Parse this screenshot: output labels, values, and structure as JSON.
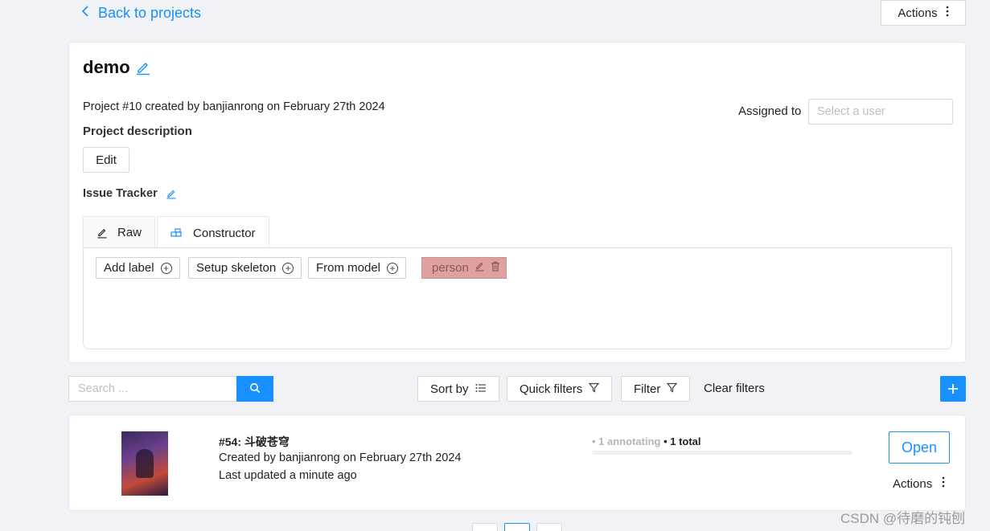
{
  "nav": {
    "back_label": "Back to projects",
    "actions_label": "Actions"
  },
  "project": {
    "name": "demo",
    "meta": "Project #10 created by banjianrong on February 27th 2024",
    "description_label": "Project description",
    "edit_label": "Edit",
    "assigned_label": "Assigned to",
    "assign_placeholder": "Select a user",
    "issue_tracker_label": "Issue Tracker",
    "tabs": [
      {
        "label": "Raw",
        "icon": "pencil-icon"
      },
      {
        "label": "Constructor",
        "icon": "blocks-icon"
      }
    ],
    "active_tab": "Constructor",
    "constructor": {
      "add_label": "Add label",
      "setup_skeleton": "Setup skeleton",
      "from_model": "From model",
      "labels": [
        {
          "name": "person",
          "color": "#dfa0a0"
        }
      ]
    }
  },
  "toolbar": {
    "search_placeholder": "Search ...",
    "sort_by": "Sort by",
    "quick_filters": "Quick filters",
    "filter": "Filter",
    "clear_filters": "Clear filters"
  },
  "tasks": [
    {
      "title": "#54: 斗破苍穹",
      "created": "Created by banjianrong on February 27th 2024",
      "updated": "Last updated a minute ago",
      "status_annotating": "• 1 annotating",
      "status_total": " • 1 total",
      "progress": 0,
      "open_label": "Open",
      "actions_label": "Actions"
    }
  ],
  "watermark": "CSDN @待磨的钝刨",
  "colors": {
    "accent": "#1890ff",
    "label_person": "#dfa0a0"
  }
}
